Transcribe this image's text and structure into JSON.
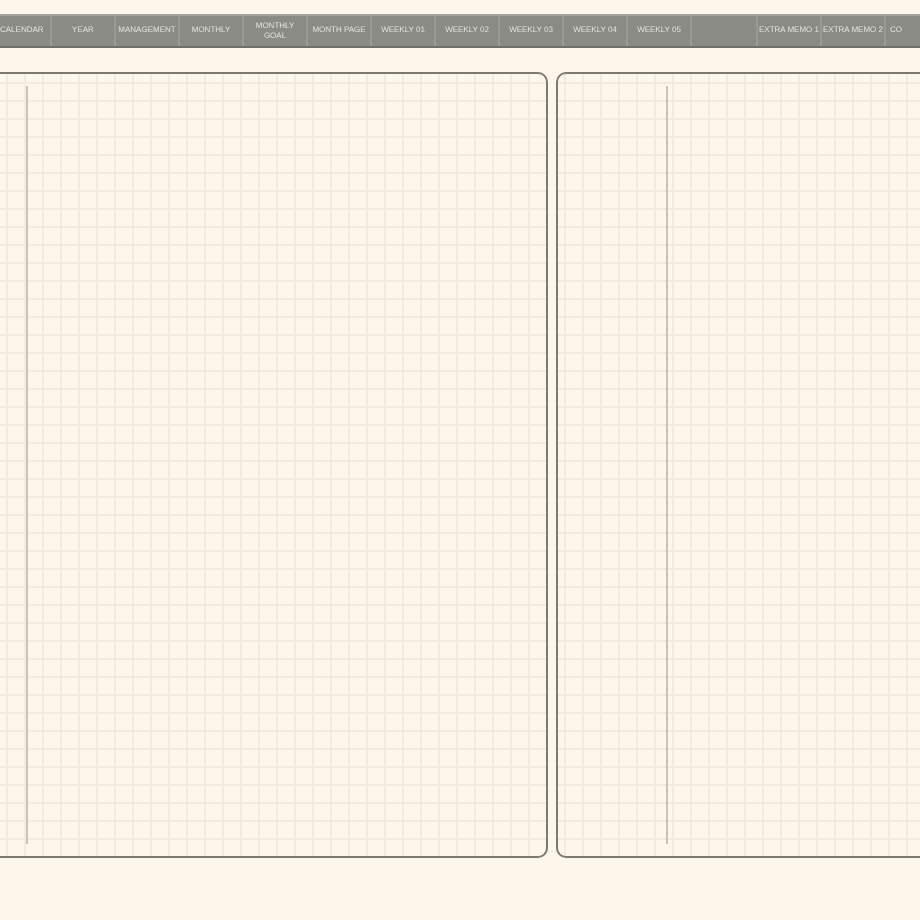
{
  "tabs": [
    {
      "kind": "tab",
      "label": "CALENDAR"
    },
    {
      "kind": "tab",
      "label": "YEAR"
    },
    {
      "kind": "tab",
      "label": "MANAGEMENT"
    },
    {
      "kind": "tab",
      "label": "MONTHLY"
    },
    {
      "kind": "tab",
      "label": "MONTHLY GOAL"
    },
    {
      "kind": "tab",
      "label": "MONTH PAGE"
    },
    {
      "kind": "tab",
      "label": "WEEKLY 01"
    },
    {
      "kind": "tab",
      "label": "WEEKLY 02"
    },
    {
      "kind": "tab",
      "label": "WEEKLY 03"
    },
    {
      "kind": "tab",
      "label": "WEEKLY 04"
    },
    {
      "kind": "tab",
      "label": "WEEKLY 05"
    },
    {
      "kind": "blank"
    },
    {
      "kind": "tab",
      "label": "EXTRA MEMO 1"
    },
    {
      "kind": "tab",
      "label": "EXTRA MEMO 2"
    },
    {
      "kind": "tab",
      "label": "CO"
    }
  ],
  "pages": [
    {
      "kind": "grid"
    },
    {
      "kind": "grid"
    }
  ]
}
